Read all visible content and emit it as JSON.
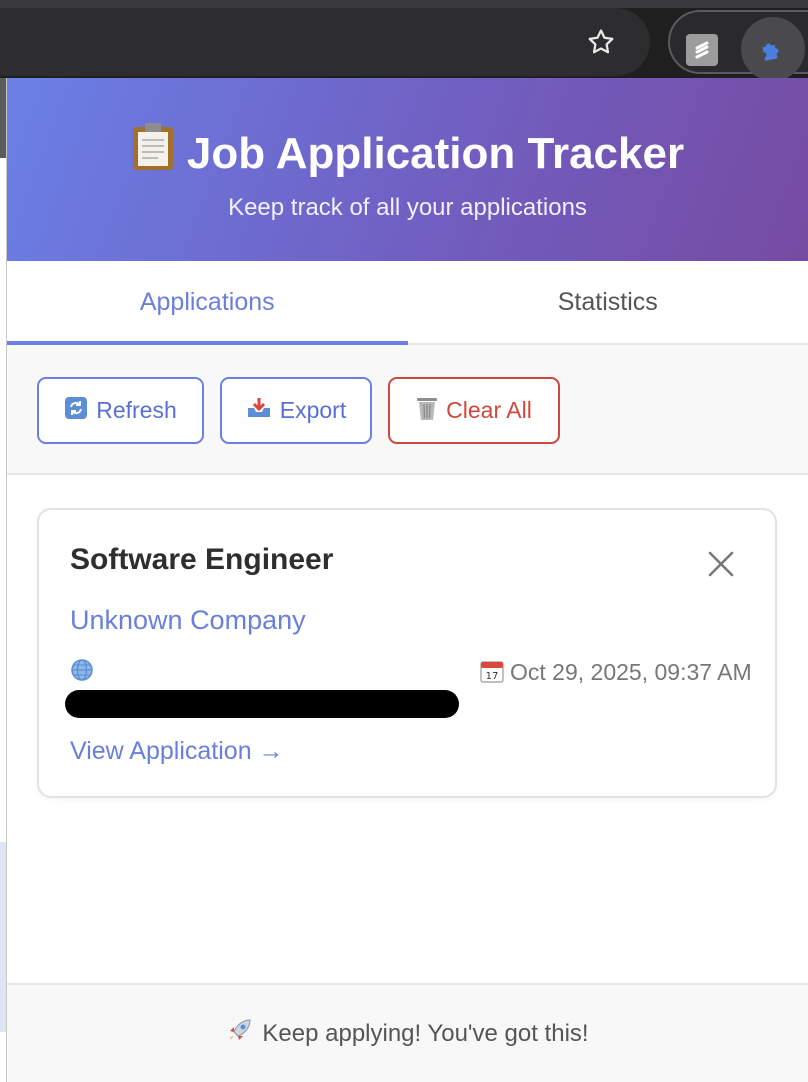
{
  "header": {
    "title": "Job Application Tracker",
    "subtitle": "Keep track of all your applications",
    "icon": "clipboard-icon"
  },
  "tabs": [
    {
      "label": "Applications",
      "active": true
    },
    {
      "label": "Statistics",
      "active": false
    }
  ],
  "actions": {
    "refresh_label": "Refresh",
    "export_label": "Export",
    "clear_label": "Clear All"
  },
  "application": {
    "title": "Software Engineer",
    "company": "Unknown Company",
    "date": "Oct 29, 2025, 09:37 AM",
    "link_label": "View Application →"
  },
  "footer": {
    "message": "Keep applying! You've got this!",
    "icon": "rocket-icon"
  },
  "colors": {
    "accent": "#6a80e6",
    "gradient_end": "#764ba2",
    "danger": "#d0473b"
  }
}
